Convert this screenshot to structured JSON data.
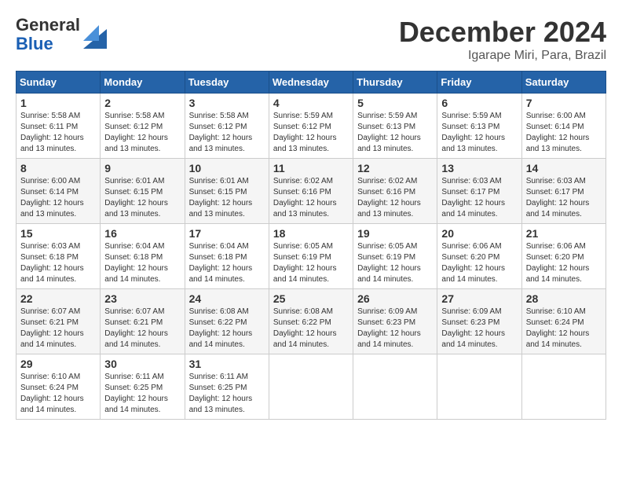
{
  "header": {
    "logo_general": "General",
    "logo_blue": "Blue",
    "month_title": "December 2024",
    "location": "Igarape Miri, Para, Brazil"
  },
  "weekdays": [
    "Sunday",
    "Monday",
    "Tuesday",
    "Wednesday",
    "Thursday",
    "Friday",
    "Saturday"
  ],
  "weeks": [
    [
      {
        "day": "1",
        "sunrise": "5:58 AM",
        "sunset": "6:11 PM",
        "daylight": "12 hours and 13 minutes."
      },
      {
        "day": "2",
        "sunrise": "5:58 AM",
        "sunset": "6:12 PM",
        "daylight": "12 hours and 13 minutes."
      },
      {
        "day": "3",
        "sunrise": "5:58 AM",
        "sunset": "6:12 PM",
        "daylight": "12 hours and 13 minutes."
      },
      {
        "day": "4",
        "sunrise": "5:59 AM",
        "sunset": "6:12 PM",
        "daylight": "12 hours and 13 minutes."
      },
      {
        "day": "5",
        "sunrise": "5:59 AM",
        "sunset": "6:13 PM",
        "daylight": "12 hours and 13 minutes."
      },
      {
        "day": "6",
        "sunrise": "5:59 AM",
        "sunset": "6:13 PM",
        "daylight": "12 hours and 13 minutes."
      },
      {
        "day": "7",
        "sunrise": "6:00 AM",
        "sunset": "6:14 PM",
        "daylight": "12 hours and 13 minutes."
      }
    ],
    [
      {
        "day": "8",
        "sunrise": "6:00 AM",
        "sunset": "6:14 PM",
        "daylight": "12 hours and 13 minutes."
      },
      {
        "day": "9",
        "sunrise": "6:01 AM",
        "sunset": "6:15 PM",
        "daylight": "12 hours and 13 minutes."
      },
      {
        "day": "10",
        "sunrise": "6:01 AM",
        "sunset": "6:15 PM",
        "daylight": "12 hours and 13 minutes."
      },
      {
        "day": "11",
        "sunrise": "6:02 AM",
        "sunset": "6:16 PM",
        "daylight": "12 hours and 13 minutes."
      },
      {
        "day": "12",
        "sunrise": "6:02 AM",
        "sunset": "6:16 PM",
        "daylight": "12 hours and 13 minutes."
      },
      {
        "day": "13",
        "sunrise": "6:03 AM",
        "sunset": "6:17 PM",
        "daylight": "12 hours and 14 minutes."
      },
      {
        "day": "14",
        "sunrise": "6:03 AM",
        "sunset": "6:17 PM",
        "daylight": "12 hours and 14 minutes."
      }
    ],
    [
      {
        "day": "15",
        "sunrise": "6:03 AM",
        "sunset": "6:18 PM",
        "daylight": "12 hours and 14 minutes."
      },
      {
        "day": "16",
        "sunrise": "6:04 AM",
        "sunset": "6:18 PM",
        "daylight": "12 hours and 14 minutes."
      },
      {
        "day": "17",
        "sunrise": "6:04 AM",
        "sunset": "6:18 PM",
        "daylight": "12 hours and 14 minutes."
      },
      {
        "day": "18",
        "sunrise": "6:05 AM",
        "sunset": "6:19 PM",
        "daylight": "12 hours and 14 minutes."
      },
      {
        "day": "19",
        "sunrise": "6:05 AM",
        "sunset": "6:19 PM",
        "daylight": "12 hours and 14 minutes."
      },
      {
        "day": "20",
        "sunrise": "6:06 AM",
        "sunset": "6:20 PM",
        "daylight": "12 hours and 14 minutes."
      },
      {
        "day": "21",
        "sunrise": "6:06 AM",
        "sunset": "6:20 PM",
        "daylight": "12 hours and 14 minutes."
      }
    ],
    [
      {
        "day": "22",
        "sunrise": "6:07 AM",
        "sunset": "6:21 PM",
        "daylight": "12 hours and 14 minutes."
      },
      {
        "day": "23",
        "sunrise": "6:07 AM",
        "sunset": "6:21 PM",
        "daylight": "12 hours and 14 minutes."
      },
      {
        "day": "24",
        "sunrise": "6:08 AM",
        "sunset": "6:22 PM",
        "daylight": "12 hours and 14 minutes."
      },
      {
        "day": "25",
        "sunrise": "6:08 AM",
        "sunset": "6:22 PM",
        "daylight": "12 hours and 14 minutes."
      },
      {
        "day": "26",
        "sunrise": "6:09 AM",
        "sunset": "6:23 PM",
        "daylight": "12 hours and 14 minutes."
      },
      {
        "day": "27",
        "sunrise": "6:09 AM",
        "sunset": "6:23 PM",
        "daylight": "12 hours and 14 minutes."
      },
      {
        "day": "28",
        "sunrise": "6:10 AM",
        "sunset": "6:24 PM",
        "daylight": "12 hours and 14 minutes."
      }
    ],
    [
      {
        "day": "29",
        "sunrise": "6:10 AM",
        "sunset": "6:24 PM",
        "daylight": "12 hours and 14 minutes."
      },
      {
        "day": "30",
        "sunrise": "6:11 AM",
        "sunset": "6:25 PM",
        "daylight": "12 hours and 14 minutes."
      },
      {
        "day": "31",
        "sunrise": "6:11 AM",
        "sunset": "6:25 PM",
        "daylight": "12 hours and 13 minutes."
      },
      null,
      null,
      null,
      null
    ]
  ],
  "labels": {
    "sunrise": "Sunrise:",
    "sunset": "Sunset:",
    "daylight": "Daylight:"
  }
}
